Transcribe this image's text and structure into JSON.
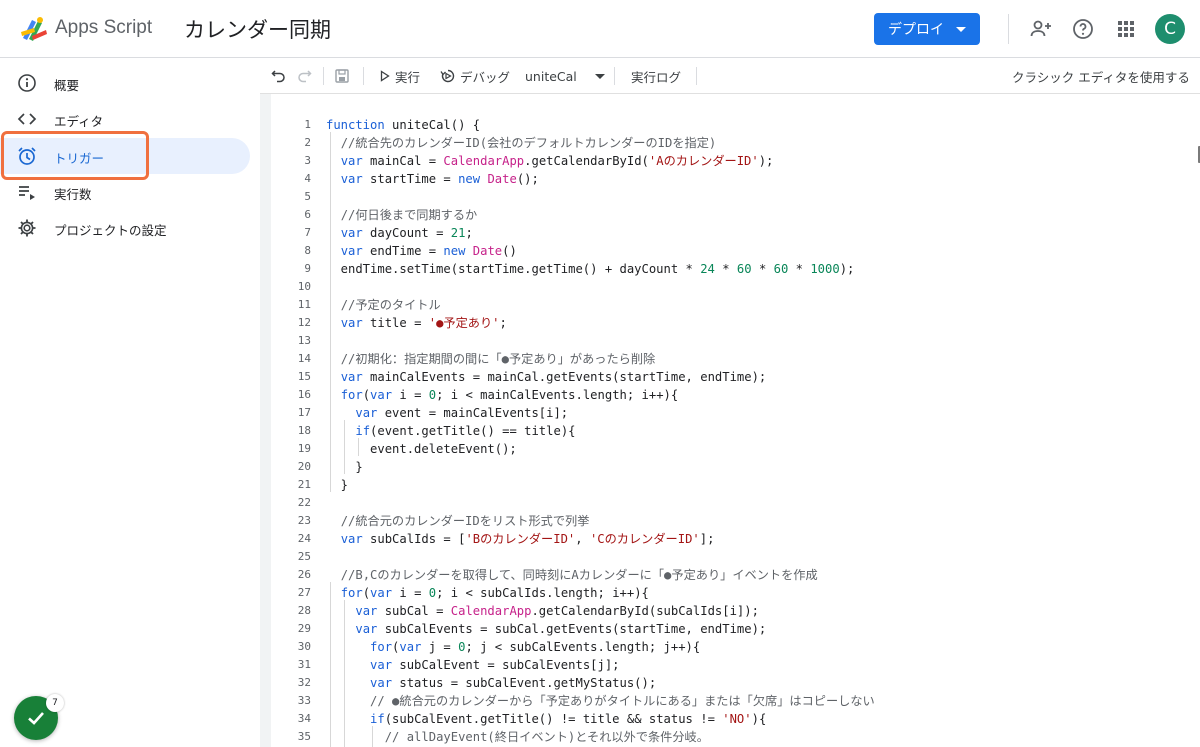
{
  "header": {
    "app_name": "Apps Script",
    "project_title": "カレンダー同期",
    "deploy_label": "デプロイ",
    "avatar_letter": "C",
    "brand_color": "#1a73e8",
    "avatar_color": "#1e8e6e"
  },
  "sidebar": {
    "items": [
      {
        "label": "概要",
        "icon": "info-icon"
      },
      {
        "label": "エディタ",
        "icon": "code-brackets-icon"
      },
      {
        "label": "トリガー",
        "icon": "alarm-clock-icon",
        "active": true
      },
      {
        "label": "実行数",
        "icon": "list-play-icon"
      },
      {
        "label": "プロジェクトの設定",
        "icon": "gear-icon"
      }
    ],
    "fab_badge": "7"
  },
  "toolbar": {
    "run_label": "実行",
    "debug_label": "デバッグ",
    "function_name": "uniteCal",
    "log_label": "実行ログ",
    "classic_label": "クラシック エディタを使用する"
  },
  "code": {
    "lines": [
      "function uniteCal() {",
      "  //統合先のカレンダーID(会社のデフォルトカレンダーのIDを指定)",
      "  var mainCal = CalendarApp.getCalendarById('AのカレンダーID');",
      "  var startTime = new Date();",
      "",
      "  //何日後まで同期するか",
      "  var dayCount = 21;",
      "  var endTime = new Date()",
      "  endTime.setTime(startTime.getTime() + dayCount * 24 * 60 * 60 * 1000);",
      "",
      "  //予定のタイトル",
      "  var title = '●予定あり';",
      "",
      "  //初期化：指定期間の間に「●予定あり」があったら削除",
      "  var mainCalEvents = mainCal.getEvents(startTime, endTime);",
      "  for(var i = 0; i < mainCalEvents.length; i++){",
      "    var event = mainCalEvents[i];",
      "    if(event.getTitle() == title){",
      "      event.deleteEvent();",
      "    }",
      "  }",
      "",
      "  //統合元のカレンダーIDをリスト形式で列挙",
      "  var subCalIds = ['BのカレンダーID', 'CのカレンダーID'];",
      "",
      "  //B,Cのカレンダーを取得して、同時刻にAカレンダーに「●予定あり」イベントを作成",
      "  for(var i = 0; i < subCalIds.length; i++){",
      "    var subCal = CalendarApp.getCalendarById(subCalIds[i]);",
      "    var subCalEvents = subCal.getEvents(startTime, endTime);",
      "      for(var j = 0; j < subCalEvents.length; j++){",
      "      var subCalEvent = subCalEvents[j];",
      "      var status = subCalEvent.getMyStatus();",
      "      // ●統合元のカレンダーから「予定ありがタイトルにある」または「欠席」はコピーしない",
      "      if(subCalEvent.getTitle() != title && status != 'NO'){",
      "        // allDayEvent(終日イベント)とそれ以外で条件分岐。"
    ]
  }
}
